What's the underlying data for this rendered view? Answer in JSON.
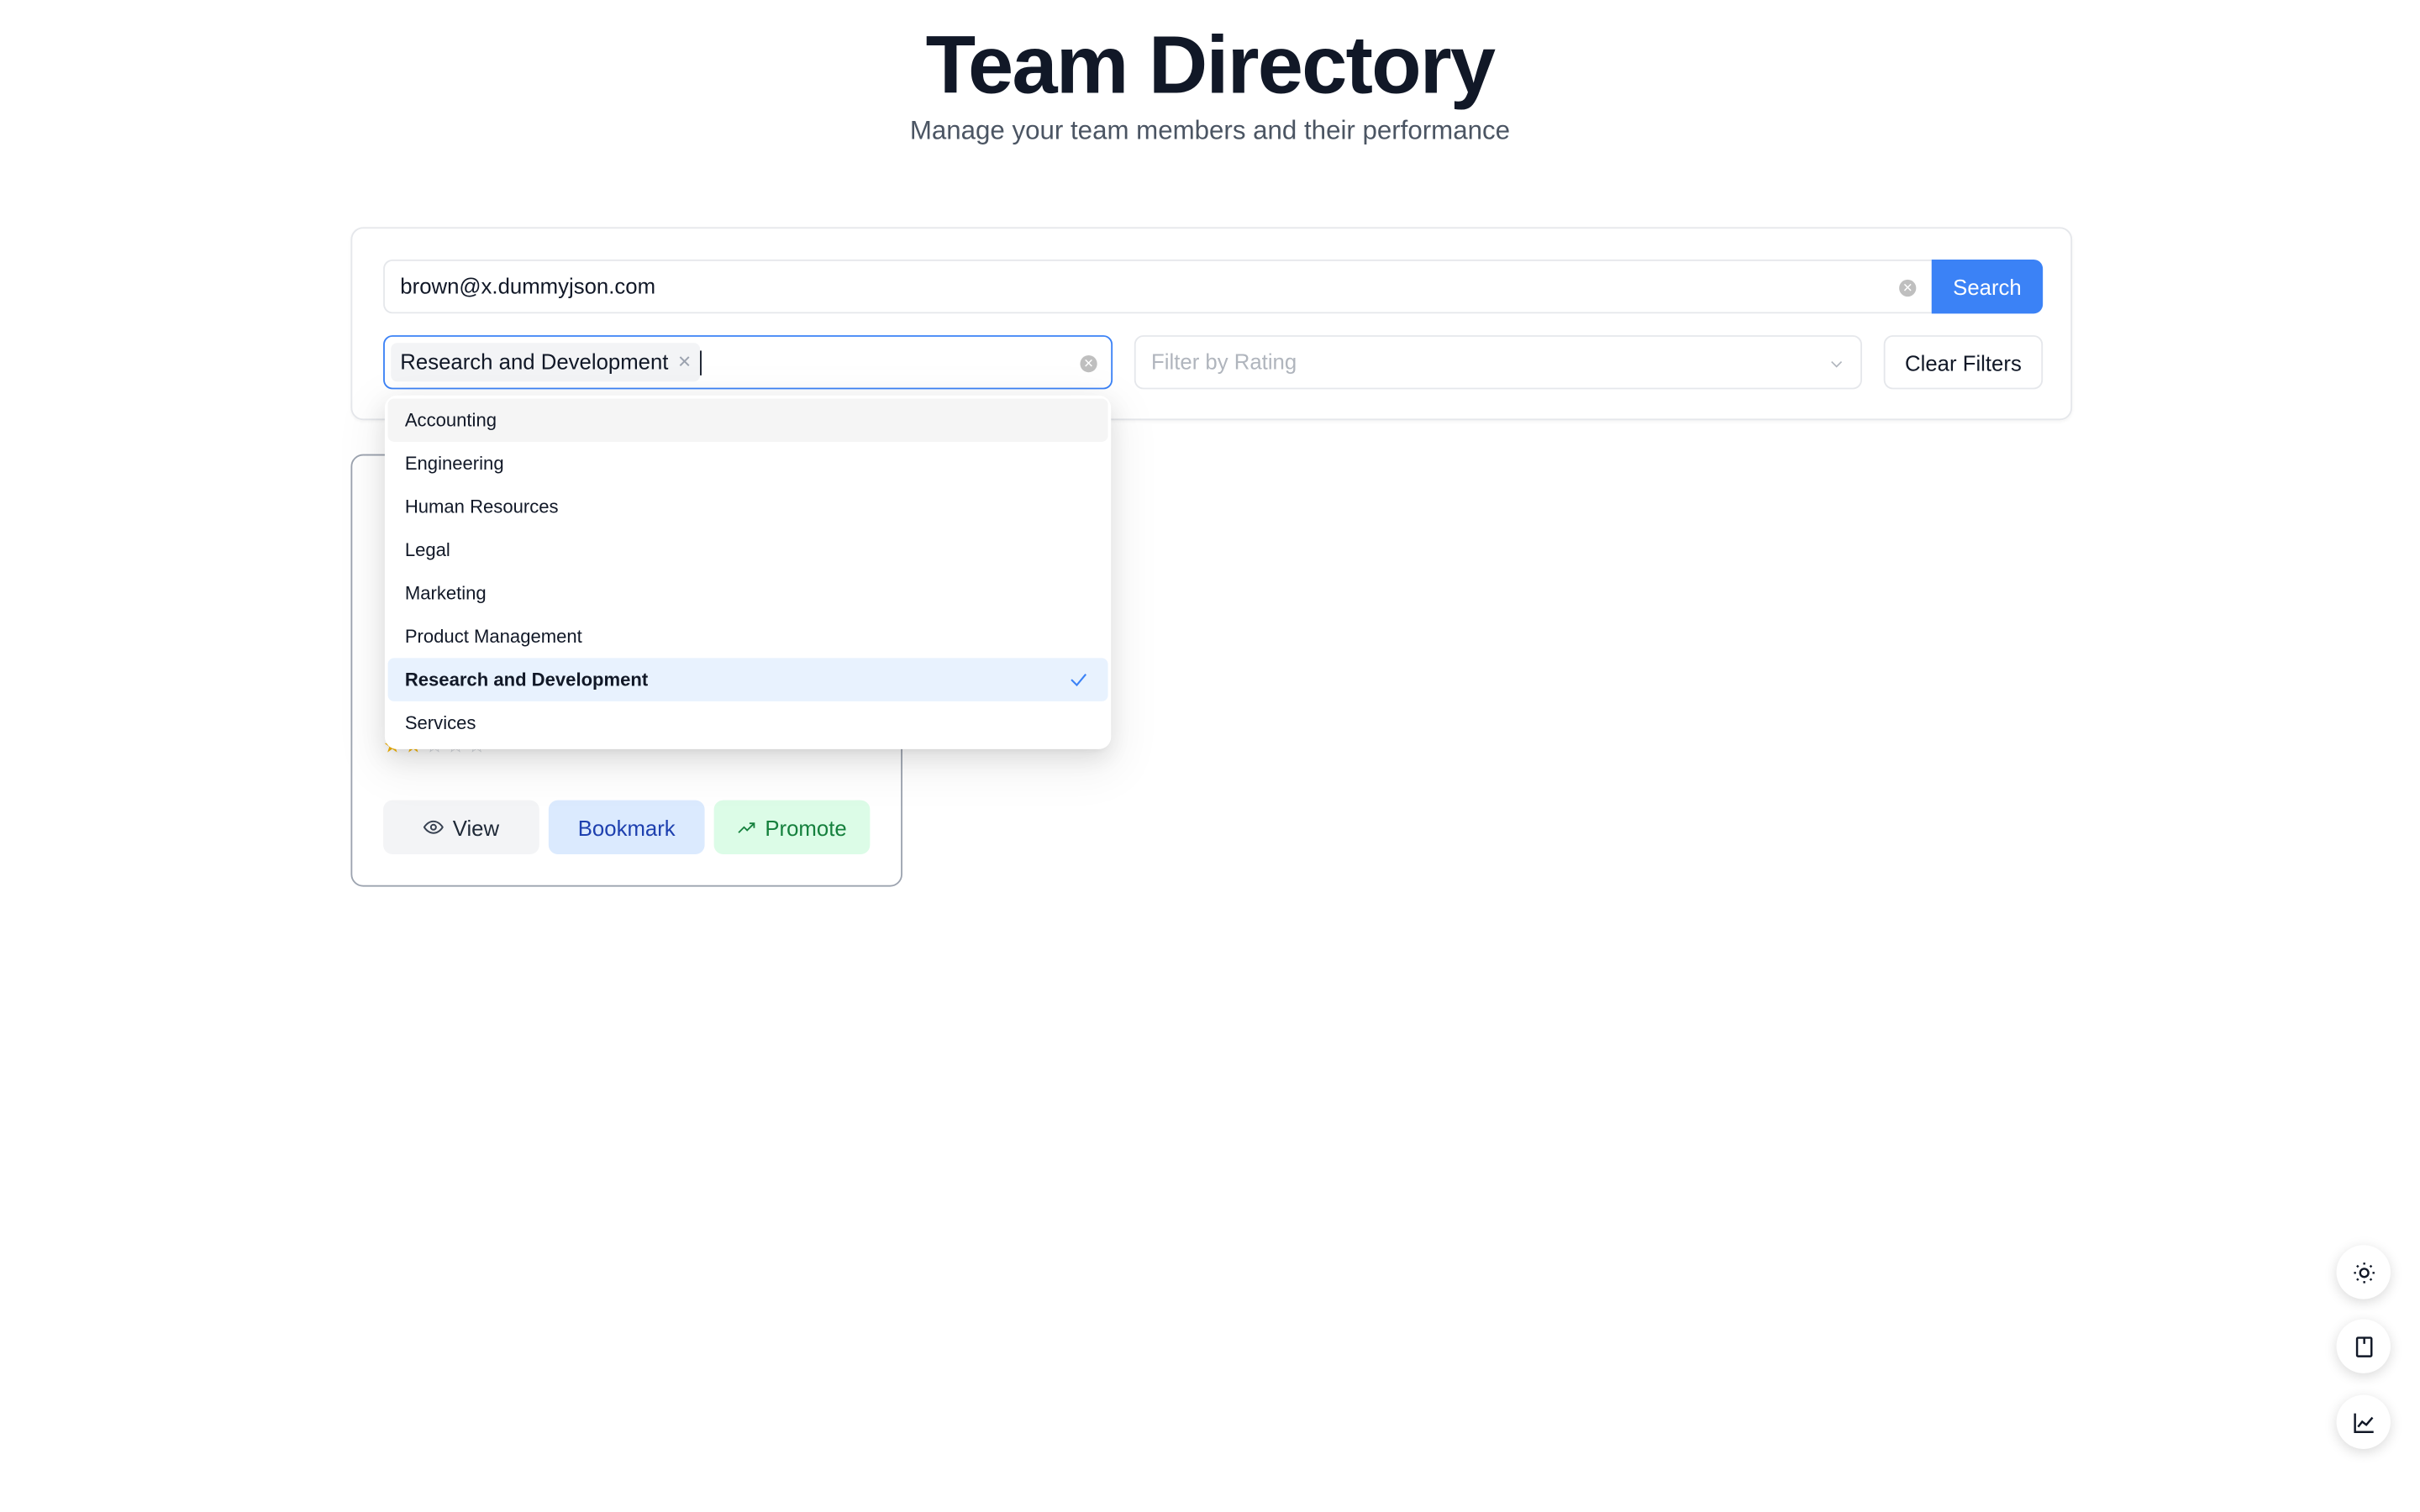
{
  "header": {
    "title": "Team Directory",
    "subtitle": "Manage your team members and their performance"
  },
  "filters": {
    "search_value": "brown@x.dummyjson.com",
    "search_button": "Search",
    "department_tags": [
      "Research and Development"
    ],
    "rating_placeholder": "Filter by Rating",
    "clear_button": "Clear Filters"
  },
  "dropdown": {
    "options": [
      "Accounting",
      "Engineering",
      "Human Resources",
      "Legal",
      "Marketing",
      "Product Management",
      "Research and Development",
      "Services"
    ],
    "active_option": "Accounting",
    "selected_option": "Research and Development"
  },
  "card": {
    "rating": 2,
    "rating_max": 5,
    "actions": {
      "view": "View",
      "bookmark": "Bookmark",
      "promote": "Promote"
    }
  },
  "floating_actions": [
    "sun-icon",
    "bookmark-icon",
    "chart-line-icon"
  ],
  "colors": {
    "primary": "#3b82f6",
    "star": "#f5b400",
    "selected_bg": "#e8f2fe"
  }
}
